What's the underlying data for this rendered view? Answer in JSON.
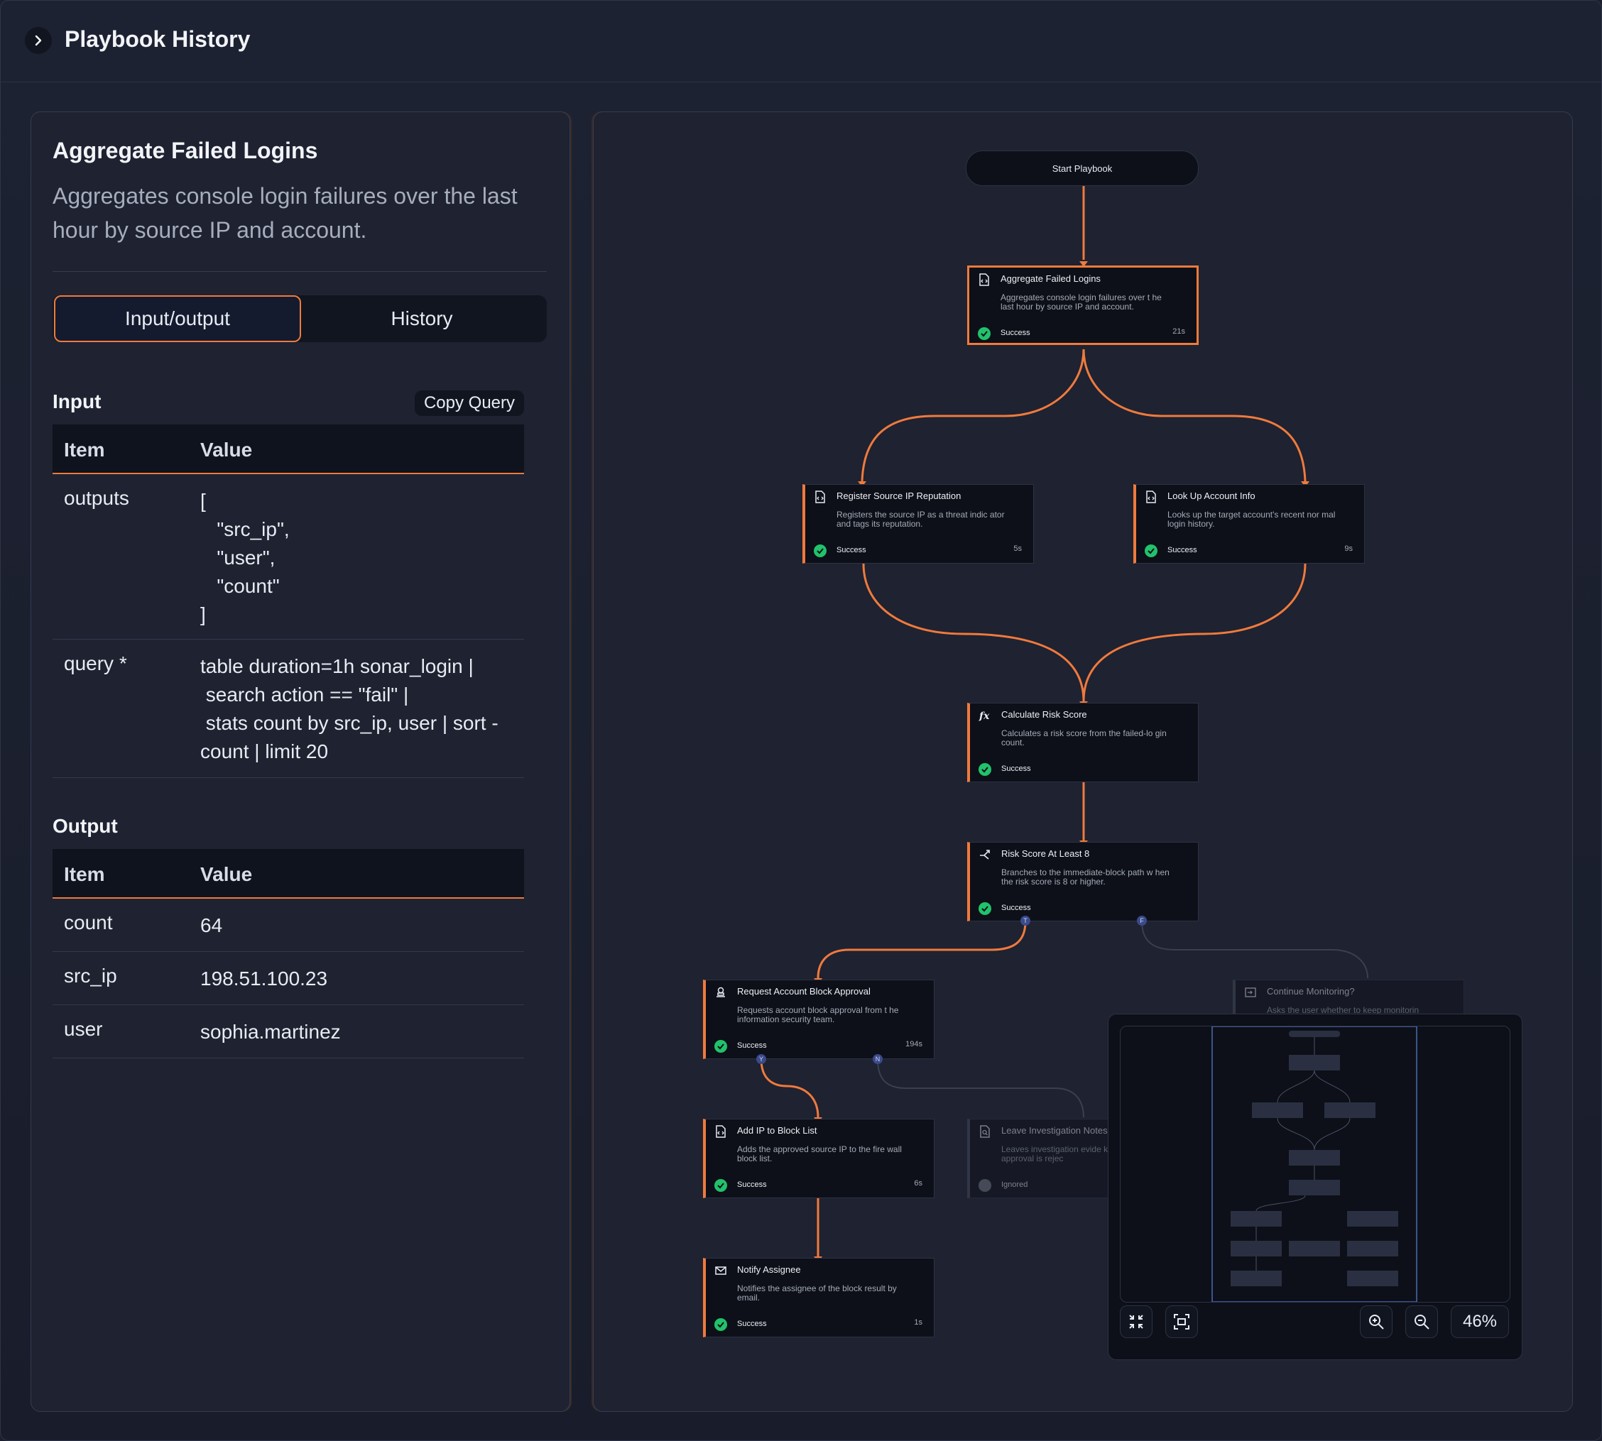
{
  "header": {
    "title": "Playbook History"
  },
  "detail": {
    "title": "Aggregate Failed Logins",
    "description": "Aggregates console login failures over the last hour by source IP and account.",
    "tabs": [
      {
        "label": "Input/output",
        "active": true
      },
      {
        "label": "History",
        "active": false
      }
    ],
    "input": {
      "label": "Input",
      "copy_label": "Copy Query",
      "col_item": "Item",
      "col_value": "Value",
      "rows": [
        {
          "item": "outputs",
          "value": "[\n   \"src_ip\",\n   \"user\",\n   \"count\"\n]"
        },
        {
          "item": "query *",
          "value": "table duration=1h sonar_login |\n search action == \"fail\" |\n stats count by src_ip, user | sort -\ncount | limit 20"
        }
      ]
    },
    "output": {
      "label": "Output",
      "col_item": "Item",
      "col_value": "Value",
      "rows": [
        {
          "item": "count",
          "value": "64"
        },
        {
          "item": "src_ip",
          "value": "198.51.100.23"
        },
        {
          "item": "user",
          "value": "sophia.martinez"
        }
      ]
    }
  },
  "flow": {
    "start_label": "Start Playbook",
    "accent_color": "#f07a3c",
    "success_color": "#21c26b",
    "nodes": [
      {
        "id": "n1",
        "title": "Aggregate Failed Logins",
        "desc": "Aggregates console login failures over t he last hour by source IP and account.",
        "status": "Success",
        "duration": "21s",
        "icon": "doc-code-icon"
      },
      {
        "id": "n2",
        "title": "Register Source IP Reputation",
        "desc": "Registers the source IP as a threat indic ator and tags its reputation.",
        "status": "Success",
        "duration": "5s",
        "icon": "doc-code-icon"
      },
      {
        "id": "n3",
        "title": "Look Up Account Info",
        "desc": "Looks up the target account's recent nor mal login history.",
        "status": "Success",
        "duration": "9s",
        "icon": "doc-code-icon"
      },
      {
        "id": "n4",
        "title": "Calculate Risk Score",
        "desc": "Calculates a risk score from the failed-lo gin count.",
        "status": "Success",
        "duration": "",
        "icon": "function-icon"
      },
      {
        "id": "n5",
        "title": "Risk Score At Least 8",
        "desc": "Branches to the immediate-block path w hen the risk score is 8 or higher.",
        "status": "Success",
        "duration": "",
        "icon": "branch-icon"
      },
      {
        "id": "n6",
        "title": "Request Account Block Approval",
        "desc": "Requests account block approval from t he information security team.",
        "status": "Success",
        "duration": "194s",
        "icon": "approval-icon"
      },
      {
        "id": "n7",
        "title": "Continue Monitoring?",
        "desc": "Asks the user whether to keep monitorin",
        "status": "",
        "duration": "",
        "icon": "prompt-icon"
      },
      {
        "id": "n8",
        "title": "Add IP to Block List",
        "desc": "Adds the approved source IP to the fire wall block list.",
        "status": "Success",
        "duration": "6s",
        "icon": "doc-code-icon"
      },
      {
        "id": "n9",
        "title": "Leave Investigation Notes",
        "desc": "Leaves investigation evide ket when approval is rejec",
        "status": "Ignored",
        "duration": "",
        "icon": "doc-search-icon"
      },
      {
        "id": "n10",
        "title": "Notify Assignee",
        "desc": "Notifies the assignee of the block result by email.",
        "status": "Success",
        "duration": "1s",
        "icon": "mail-icon"
      }
    ],
    "ports": {
      "true": "T",
      "false": "F",
      "yes": "Y",
      "no": "N"
    }
  },
  "minimap": {
    "zoom": "46%"
  }
}
